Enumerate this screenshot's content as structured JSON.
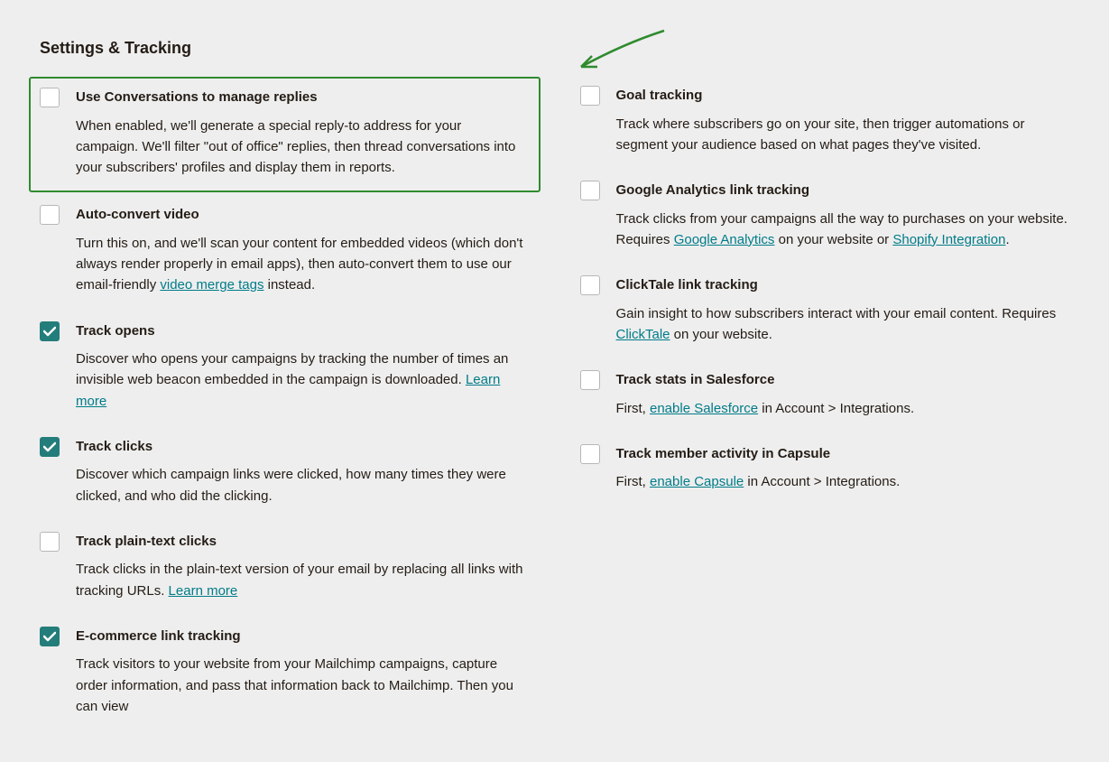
{
  "header": {
    "title": "Settings & Tracking"
  },
  "left": [
    {
      "id": "use-conversations",
      "label": "Use Conversations to manage replies",
      "checked": false,
      "highlighted": true,
      "desc": [
        {
          "t": "text",
          "v": "When enabled, we'll generate a special reply-to address for your campaign. We'll filter \"out of office\" replies, then thread conversations into your subscribers' profiles and display them in reports."
        }
      ]
    },
    {
      "id": "auto-convert-video",
      "label": "Auto-convert video",
      "checked": false,
      "desc": [
        {
          "t": "text",
          "v": "Turn this on, and we'll scan your content for embedded videos (which don't always render properly in email apps), then auto-convert them to use our email-friendly "
        },
        {
          "t": "link",
          "v": "video merge tags"
        },
        {
          "t": "text",
          "v": " instead."
        }
      ]
    },
    {
      "id": "track-opens",
      "label": "Track opens",
      "checked": true,
      "desc": [
        {
          "t": "text",
          "v": "Discover who opens your campaigns by tracking the number of times an invisible web beacon embedded in the campaign is downloaded. "
        },
        {
          "t": "link",
          "v": "Learn more"
        }
      ]
    },
    {
      "id": "track-clicks",
      "label": "Track clicks",
      "checked": true,
      "desc": [
        {
          "t": "text",
          "v": "Discover which campaign links were clicked, how many times they were clicked, and who did the clicking."
        }
      ]
    },
    {
      "id": "track-plaintext-clicks",
      "label": "Track plain-text clicks",
      "checked": false,
      "desc": [
        {
          "t": "text",
          "v": "Track clicks in the plain-text version of your email by replacing all links with tracking URLs. "
        },
        {
          "t": "link",
          "v": "Learn more"
        }
      ]
    },
    {
      "id": "ecommerce-link-tracking",
      "label": "E-commerce link tracking",
      "checked": true,
      "desc": [
        {
          "t": "text",
          "v": "Track visitors to your website from your Mailchimp campaigns, capture order information, and pass that information back to Mailchimp. Then you can view"
        }
      ]
    }
  ],
  "right": [
    {
      "id": "goal-tracking",
      "label": "Goal tracking",
      "checked": false,
      "desc": [
        {
          "t": "text",
          "v": "Track where subscribers go on your site, then trigger automations or segment your audience based on what pages they've visited."
        }
      ]
    },
    {
      "id": "ga-link-tracking",
      "label": "Google Analytics link tracking",
      "checked": false,
      "desc": [
        {
          "t": "text",
          "v": "Track clicks from your campaigns all the way to purchases on your website. Requires "
        },
        {
          "t": "link",
          "v": "Google Analytics"
        },
        {
          "t": "text",
          "v": " on your website or "
        },
        {
          "t": "link",
          "v": "Shopify Integration"
        },
        {
          "t": "text",
          "v": "."
        }
      ]
    },
    {
      "id": "clicktale-link-tracking",
      "label": "ClickTale link tracking",
      "checked": false,
      "desc": [
        {
          "t": "text",
          "v": "Gain insight to how subscribers interact with your email content. Requires "
        },
        {
          "t": "link",
          "v": "ClickTale"
        },
        {
          "t": "text",
          "v": " on your website."
        }
      ]
    },
    {
      "id": "track-stats-salesforce",
      "label": "Track stats in Salesforce",
      "checked": false,
      "desc": [
        {
          "t": "text",
          "v": "First, "
        },
        {
          "t": "link",
          "v": "enable Salesforce"
        },
        {
          "t": "text",
          "v": " in Account > Integrations."
        }
      ]
    },
    {
      "id": "track-member-capsule",
      "label": "Track member activity in Capsule",
      "checked": false,
      "desc": [
        {
          "t": "text",
          "v": "First, "
        },
        {
          "t": "link",
          "v": "enable Capsule"
        },
        {
          "t": "text",
          "v": " in Account > Integrations."
        }
      ]
    }
  ]
}
